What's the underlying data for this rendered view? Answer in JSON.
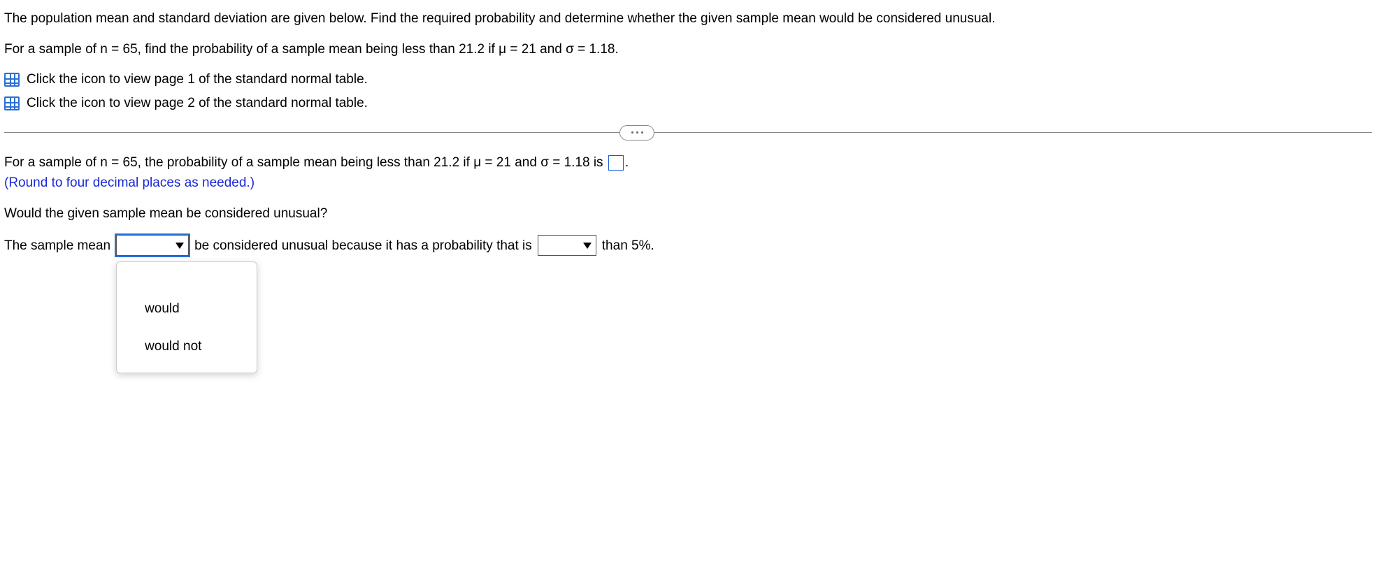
{
  "problem": {
    "intro": "The population mean and standard deviation are given below. Find the required probability and determine whether the given sample mean would be considered unusual.",
    "setup": "For a sample of n = 65, find the probability of a sample mean being less than 21.2 if μ = 21 and σ = 1.18."
  },
  "links": {
    "page1": "Click the icon to view page 1 of the standard normal table.",
    "page2": "Click the icon to view page 2 of the standard normal table."
  },
  "answer": {
    "line_prefix": "For a sample of n = 65, the probability of a sample mean being less than 21.2 if μ = 21 and σ = 1.18 is",
    "line_suffix": ".",
    "rounding_note": "(Round to four decimal places as needed.)",
    "question2": "Would the given sample mean be considered unusual?",
    "sentence": {
      "p1": "The sample mean",
      "p2": "be considered unusual because it has a probability that is",
      "p3": "than 5%."
    }
  },
  "dropdown1": {
    "options": [
      "would",
      "would not"
    ]
  }
}
